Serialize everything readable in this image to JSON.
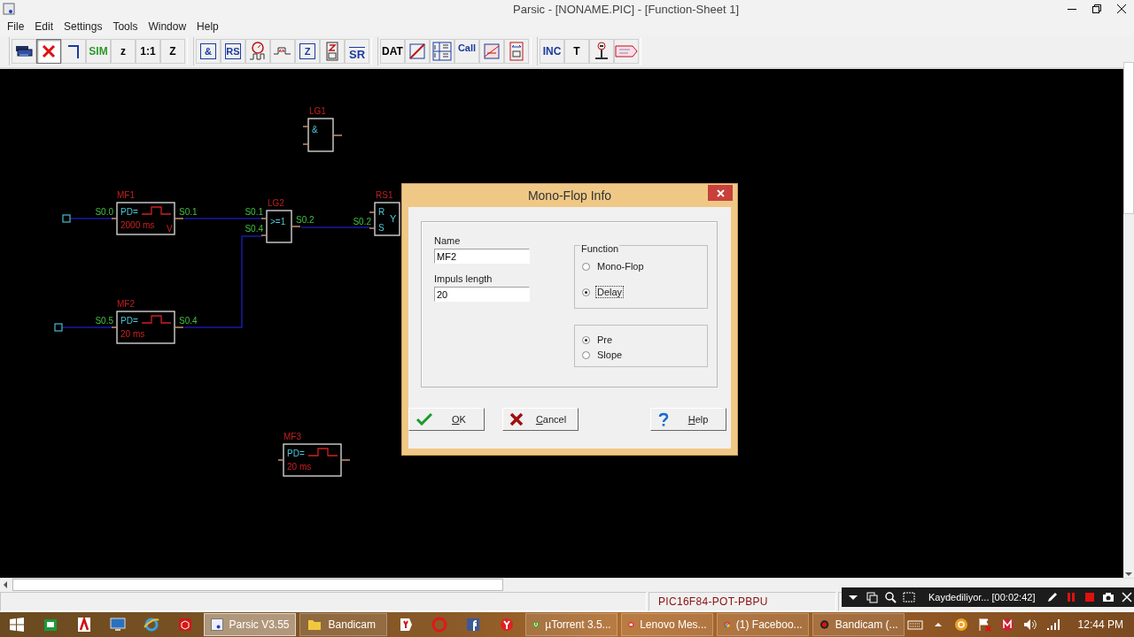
{
  "window": {
    "title": "Parsic - [NONAME.PIC] - [Function-Sheet 1]",
    "menu": [
      "File",
      "Edit",
      "Settings",
      "Tools",
      "Window",
      "Help"
    ]
  },
  "toolbar": [
    [
      {
        "kind": "printer",
        "pressed": false
      },
      {
        "kind": "delete",
        "pressed": true
      },
      {
        "kind": "wire",
        "pressed": false
      },
      {
        "kind": "text",
        "label": "SIM",
        "color": "#2a9a2a",
        "pressed": false
      },
      {
        "kind": "text",
        "label": "z",
        "color": "#000000",
        "pressed": false
      },
      {
        "kind": "text",
        "label": "1:1",
        "color": "#000000",
        "pressed": false
      },
      {
        "kind": "text",
        "label": "Z",
        "color": "#000000",
        "pressed": false
      }
    ],
    [
      {
        "kind": "boxtext",
        "label": "&",
        "color": "#1a3aa0",
        "pressed": false
      },
      {
        "kind": "boxtext",
        "label": "RS",
        "color": "#1a3aa0",
        "pressed": false
      },
      {
        "kind": "timer",
        "pressed": false
      },
      {
        "kind": "pulse",
        "pressed": false
      },
      {
        "kind": "boxtext",
        "label": "Z",
        "color": "#1a3aa0",
        "pressed": false
      },
      {
        "kind": "chip",
        "pressed": false
      },
      {
        "kind": "arrowtext",
        "label": "SR",
        "color": "#1a3aa0",
        "pressed": false
      }
    ],
    [
      {
        "kind": "text",
        "label": "DAT",
        "color": "#000000",
        "pressed": false
      },
      {
        "kind": "ramp",
        "pressed": false
      },
      {
        "kind": "counter",
        "pressed": false
      },
      {
        "kind": "calltext",
        "label": "Call",
        "color": "#1a3aa0",
        "pressed": false
      },
      {
        "kind": "table",
        "pressed": false
      },
      {
        "kind": "byte",
        "pressed": false
      }
    ],
    [
      {
        "kind": "text",
        "label": "INC",
        "color": "#1a3aa0",
        "pressed": false
      },
      {
        "kind": "text",
        "label": "T",
        "color": "#000000",
        "pressed": false
      },
      {
        "kind": "probe",
        "pressed": false
      },
      {
        "kind": "tag",
        "pressed": false
      }
    ]
  ],
  "diagram": {
    "blocks": [
      {
        "kind": "logic",
        "name": "LG1",
        "symbol": "&"
      },
      {
        "kind": "monoflop",
        "name": "MF1",
        "lines": [
          "PD=",
          "2000 ms"
        ],
        "corner": "V",
        "inputs": [
          {
            "signal": "S0.0"
          }
        ],
        "outputs": [
          {
            "signal": "S0.1"
          }
        ]
      },
      {
        "kind": "logic",
        "name": "LG2",
        "symbol": ">=1",
        "inputs": [
          {
            "signal": "S0.1"
          },
          {
            "signal": "S0.4"
          }
        ],
        "outputs": [
          {
            "signal": "S0.2"
          }
        ]
      },
      {
        "kind": "rs",
        "name": "RS1",
        "symbol": "Y",
        "inputs": [
          {
            "letter": "R"
          },
          {
            "letter": "S",
            "signal": "S0.2"
          }
        ]
      },
      {
        "kind": "monoflop",
        "name": "MF2",
        "lines": [
          "PD=",
          "20 ms"
        ],
        "inputs": [
          {
            "signal": "S0.5"
          }
        ],
        "outputs": [
          {
            "signal": "S0.4"
          }
        ]
      },
      {
        "kind": "monoflop",
        "name": "MF3",
        "lines": [
          "PD=",
          "20 ms"
        ]
      }
    ]
  },
  "dialog": {
    "title": "Mono-Flop Info",
    "fields": [
      {
        "label": "Name",
        "value": "MF2"
      },
      {
        "label": "Impuls length",
        "value": "20"
      }
    ],
    "function_group": {
      "title": "Function",
      "options": [
        {
          "label": "Mono-Flop",
          "selected": false,
          "focused": false
        },
        {
          "label": "Delay",
          "selected": true,
          "focused": true
        }
      ]
    },
    "trigger_group": {
      "options": [
        {
          "label": "Pre",
          "selected": true,
          "focused": false
        },
        {
          "label": "Slope",
          "selected": false,
          "focused": false
        }
      ]
    },
    "buttons": [
      {
        "kind": "ok",
        "label": "OK"
      },
      {
        "kind": "cancel",
        "label": "Cancel"
      },
      {
        "kind": "help",
        "label": "Help"
      }
    ]
  },
  "status_bar": {
    "device": "PIC16F84-POT-PBPU"
  },
  "recorder": {
    "text": "Kaydediliyor... [00:02:42]"
  },
  "taskbar": {
    "items": [
      {
        "kind": "store",
        "active": false
      },
      {
        "kind": "adobe",
        "active": false
      },
      {
        "kind": "monitor",
        "active": false
      },
      {
        "kind": "ie",
        "active": false
      },
      {
        "kind": "cube",
        "active": false
      },
      {
        "kind": "parsic",
        "label": "Parsic V3.55",
        "active": true
      },
      {
        "kind": "folder",
        "label": "Bandicam",
        "active": false
      },
      {
        "kind": "ybrowser",
        "active": false
      },
      {
        "kind": "opera",
        "active": false
      },
      {
        "kind": "facebook",
        "active": false
      },
      {
        "kind": "yandex",
        "active": false
      },
      {
        "kind": "utorrent",
        "label": "µTorrent 3.5...",
        "active": false
      },
      {
        "kind": "mail",
        "label": "Lenovo Mes...",
        "active": false
      },
      {
        "kind": "chrome",
        "label": "(1) Faceboo...",
        "active": false
      },
      {
        "kind": "record",
        "label": "Bandicam (...",
        "active": false
      }
    ],
    "clock": "12:44 PM"
  }
}
